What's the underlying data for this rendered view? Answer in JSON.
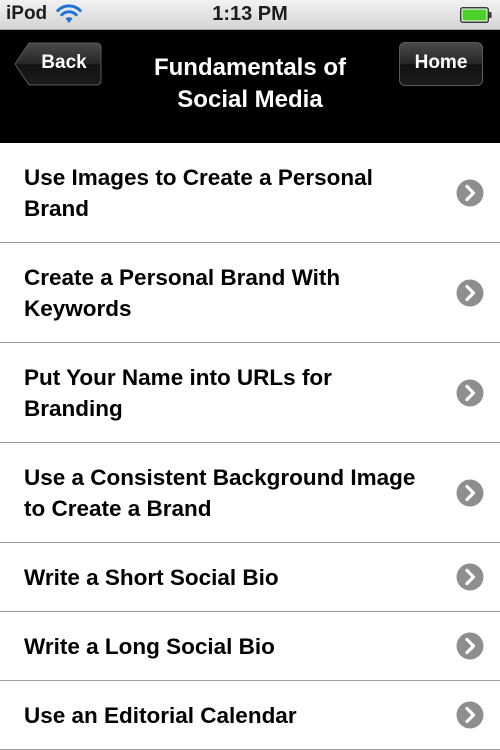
{
  "status_bar": {
    "carrier": "iPod",
    "time": "1:13 PM",
    "icons": [
      "wifi-icon",
      "battery-icon"
    ]
  },
  "nav_bar": {
    "title_line1": "Fundamentals of",
    "title_line2": "Social Media",
    "back_label": "Back",
    "home_label": "Home"
  },
  "items": [
    {
      "label": "Use Images to Create a Personal Brand"
    },
    {
      "label": "Create a Personal Brand With Keywords"
    },
    {
      "label": "Put Your Name into URLs for Branding"
    },
    {
      "label": "Use a Consistent Background Image to Create a Brand"
    },
    {
      "label": "Write a Short Social Bio"
    },
    {
      "label": "Write a Long Social Bio"
    },
    {
      "label": "Use an Editorial Calendar"
    }
  ],
  "colors": {
    "nav_background": "#000000",
    "battery_fill": "#4cd02a",
    "chevron_fill": "#8e8e8e",
    "separator": "#9e9e9e"
  }
}
